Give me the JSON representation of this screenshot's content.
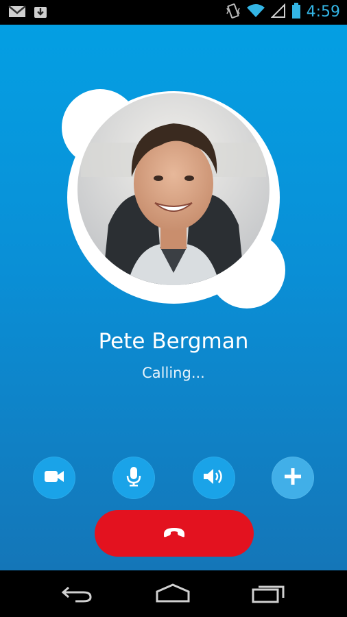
{
  "status_bar": {
    "time": "4:59",
    "icons": [
      "gmail-icon",
      "download-icon",
      "vibrate-icon",
      "wifi-icon",
      "signal-icon",
      "battery-icon"
    ]
  },
  "call": {
    "contact_name": "Pete Bergman",
    "status": "Calling..."
  },
  "controls": [
    {
      "name": "video-camera-icon"
    },
    {
      "name": "microphone-icon"
    },
    {
      "name": "speaker-icon"
    },
    {
      "name": "add-icon"
    }
  ],
  "end_call": {
    "icon": "hang-up-icon"
  },
  "nav": [
    "back-icon",
    "home-icon",
    "recent-apps-icon"
  ],
  "colors": {
    "background_top": "#049fe3",
    "background_bottom": "#1476b8",
    "control_button": "#1aa3e8",
    "end_call": "#e3121f",
    "status_time": "#33b5e5"
  }
}
